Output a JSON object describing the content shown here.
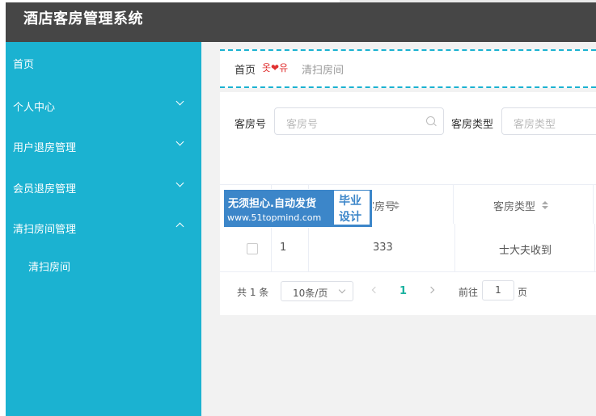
{
  "app": {
    "title": "酒店客房管理系统"
  },
  "sidebar": {
    "items": [
      {
        "label": "首页"
      },
      {
        "label": "个人中心"
      },
      {
        "label": "用户退房管理"
      },
      {
        "label": "会员退房管理"
      },
      {
        "label": "清扫房间管理"
      },
      {
        "label": "清扫房间"
      }
    ]
  },
  "breadcrumb": {
    "home": "首页",
    "separator": "옷❤유",
    "current": "清扫房间"
  },
  "filters": {
    "room_no_label": "客房号",
    "room_no_placeholder": "客房号",
    "room_type_label": "客房类型",
    "room_type_placeholder": "客房类型"
  },
  "table": {
    "headers": {
      "room_no": "客房号",
      "room_type": "客房类型"
    },
    "rows": [
      {
        "index": "1",
        "room_no": "333",
        "room_type": "士大夫收到"
      }
    ]
  },
  "pagination": {
    "total": "共 1 条",
    "page_size": "10条/页",
    "current_page": "1",
    "goto_label": "前往",
    "goto_value": "1",
    "page_suffix": "页"
  },
  "watermark": {
    "line1": "无须担心.自动发货",
    "line2": "www.51topmind.com",
    "box_line1": "毕业",
    "box_line2": "设计"
  },
  "colors": {
    "sidebar": "#1bb2d1",
    "topbar": "#464646",
    "accent": "#1bb2a0"
  }
}
